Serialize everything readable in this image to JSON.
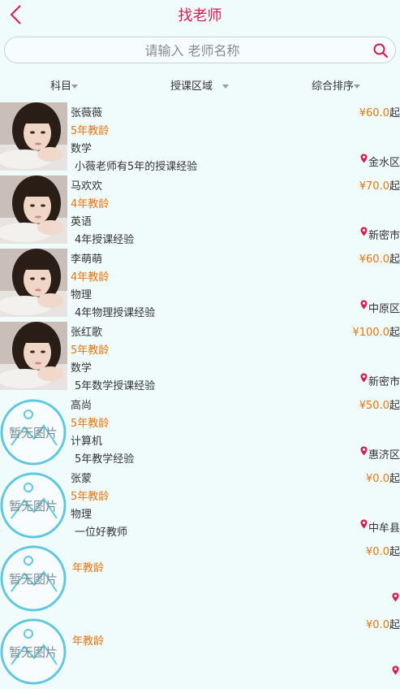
{
  "header": {
    "title": "找老师"
  },
  "search": {
    "placeholder": "请输入 老师名称",
    "value": ""
  },
  "filters": [
    {
      "label": "科目"
    },
    {
      "label": "授课区域"
    },
    {
      "label": "综合排序"
    }
  ],
  "placeholder_image_text": "暂无图片",
  "colors": {
    "accent": "#d61c4e",
    "orange": "#e8740f",
    "placeholder_ring": "#5fc8e0",
    "background": "#f0fbfc"
  },
  "teachers": [
    {
      "name": "张薇薇",
      "years": "5年教龄",
      "subject": "数学",
      "desc": "小薇老师有5年的授课经验",
      "price": "¥60.0",
      "unit": "起",
      "location": "金水区",
      "has_photo": true
    },
    {
      "name": "马欢欢",
      "years": "4年教龄",
      "subject": "英语",
      "desc": "4年授课经验",
      "price": "¥70.0",
      "unit": "起",
      "location": "新密市",
      "has_photo": true
    },
    {
      "name": "李萌萌",
      "years": "4年教龄",
      "subject": "物理",
      "desc": "4年物理授课经验",
      "price": "¥60.0",
      "unit": "起",
      "location": "中原区",
      "has_photo": true
    },
    {
      "name": "张红歌",
      "years": "5年教龄",
      "subject": "数学",
      "desc": "5年数学授课经验",
      "price": "¥100.0",
      "unit": "起",
      "location": "新密市",
      "has_photo": true
    },
    {
      "name": "高尚",
      "years": "5年教龄",
      "subject": "计算机",
      "desc": "5年教学经验",
      "price": "¥50.0",
      "unit": "起",
      "location": "惠济区",
      "has_photo": false
    },
    {
      "name": "张蒙",
      "years": "5年教龄",
      "subject": "物理",
      "desc": "一位好教师",
      "price": "¥0.0",
      "unit": "起",
      "location": "中牟县",
      "has_photo": false
    },
    {
      "name": "",
      "years": "年教龄",
      "subject": "",
      "desc": "",
      "price": "¥0.0",
      "unit": "起",
      "location": "",
      "has_photo": false
    },
    {
      "name": "",
      "years": "年教龄",
      "subject": "",
      "desc": "",
      "price": "¥0.0",
      "unit": "起",
      "location": "",
      "has_photo": false
    }
  ]
}
